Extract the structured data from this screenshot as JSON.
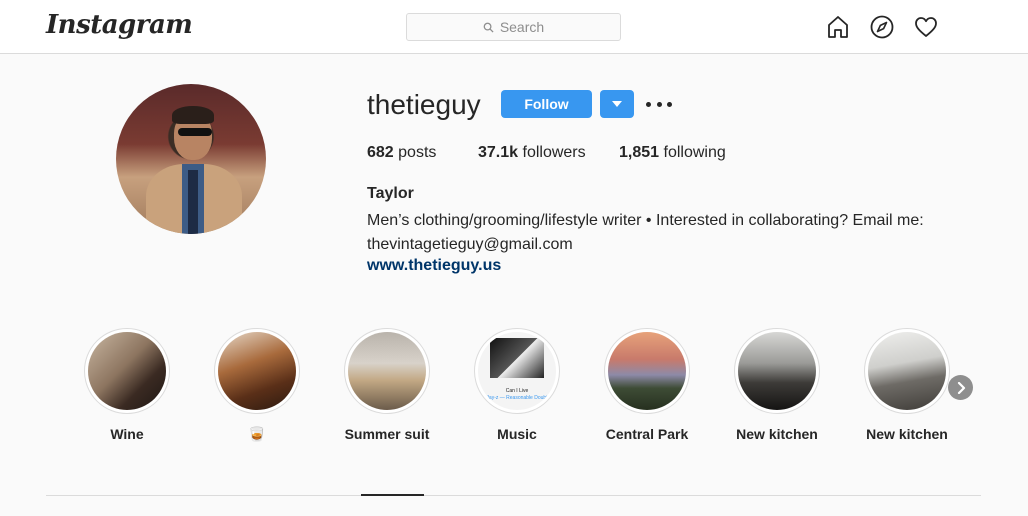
{
  "header": {
    "logo_text": "Instagram",
    "search_placeholder": "Search",
    "icons": [
      "home-icon",
      "explore-compass-icon",
      "heart-icon"
    ]
  },
  "profile": {
    "username": "thetieguy",
    "follow_label": "Follow",
    "stats": {
      "posts_count": "682",
      "posts_label": "posts",
      "followers_count": "37.1k",
      "followers_label": "followers",
      "following_count": "1,851",
      "following_label": "following"
    },
    "full_name": "Taylor",
    "bio_line1": "Men’s clothing/grooming/lifestyle writer • Interested in collaborating? Email me:",
    "bio_line2": "thevintagetieguy@gmail.com",
    "website": "www.thetieguy.us"
  },
  "highlights": [
    {
      "label": "Wine"
    },
    {
      "label": "🥃"
    },
    {
      "label": "Summer suit"
    },
    {
      "label": "Music",
      "cover_line1": "Can I Live",
      "cover_line2": "Jay-z — Reasonable Doubt"
    },
    {
      "label": "Central Park"
    },
    {
      "label": "New kitchen"
    },
    {
      "label": "New kitchen"
    }
  ],
  "colors": {
    "accent": "#3897f0",
    "link": "#003569",
    "background": "#fafafa",
    "border": "#dbdbdb"
  }
}
